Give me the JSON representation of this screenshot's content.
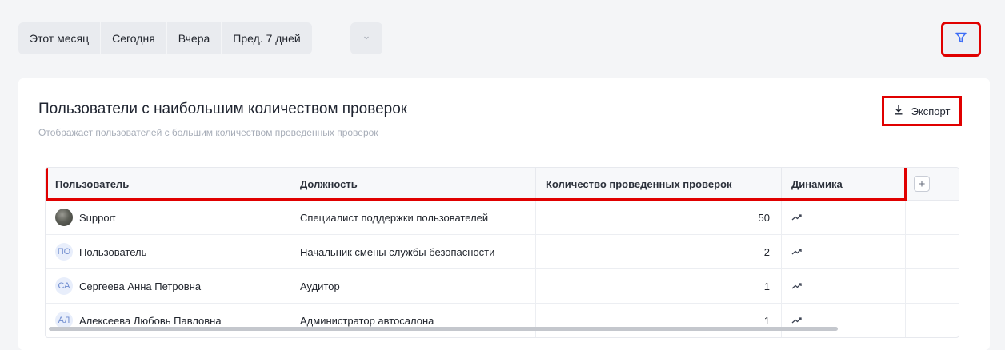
{
  "periods": [
    "Этот месяц",
    "Сегодня",
    "Вчера",
    "Пред. 7 дней"
  ],
  "icons": {
    "more": "chevron-down-icon",
    "filter": "filter-icon",
    "export": "download-icon",
    "trend": "trend-up-icon",
    "add_column": "plus-icon"
  },
  "colors": {
    "accent": "#3b6cf6",
    "highlight": "#e00000"
  },
  "card": {
    "title": "Пользователи с наибольшим количеством проверок",
    "subtitle": "Отображает пользователей с большим количеством проведенных проверок",
    "export_label": "Экспорт"
  },
  "table": {
    "columns": [
      "Пользователь",
      "Должность",
      "Количество проведенных проверок",
      "Динамика"
    ],
    "add_column_label": "+",
    "rows": [
      {
        "initials": "",
        "user": "Support",
        "position": "Специалист поддержки пользователей",
        "count": "50"
      },
      {
        "initials": "ПО",
        "user": "Пользователь",
        "position": "Начальник смены службы безопасности",
        "count": "2"
      },
      {
        "initials": "СА",
        "user": "Сергеева Анна Петровна",
        "position": "Аудитор",
        "count": "1"
      },
      {
        "initials": "АЛ",
        "user": "Алексеева Любовь Павловна",
        "position": "Администратор автосалона",
        "count": "1"
      }
    ]
  }
}
